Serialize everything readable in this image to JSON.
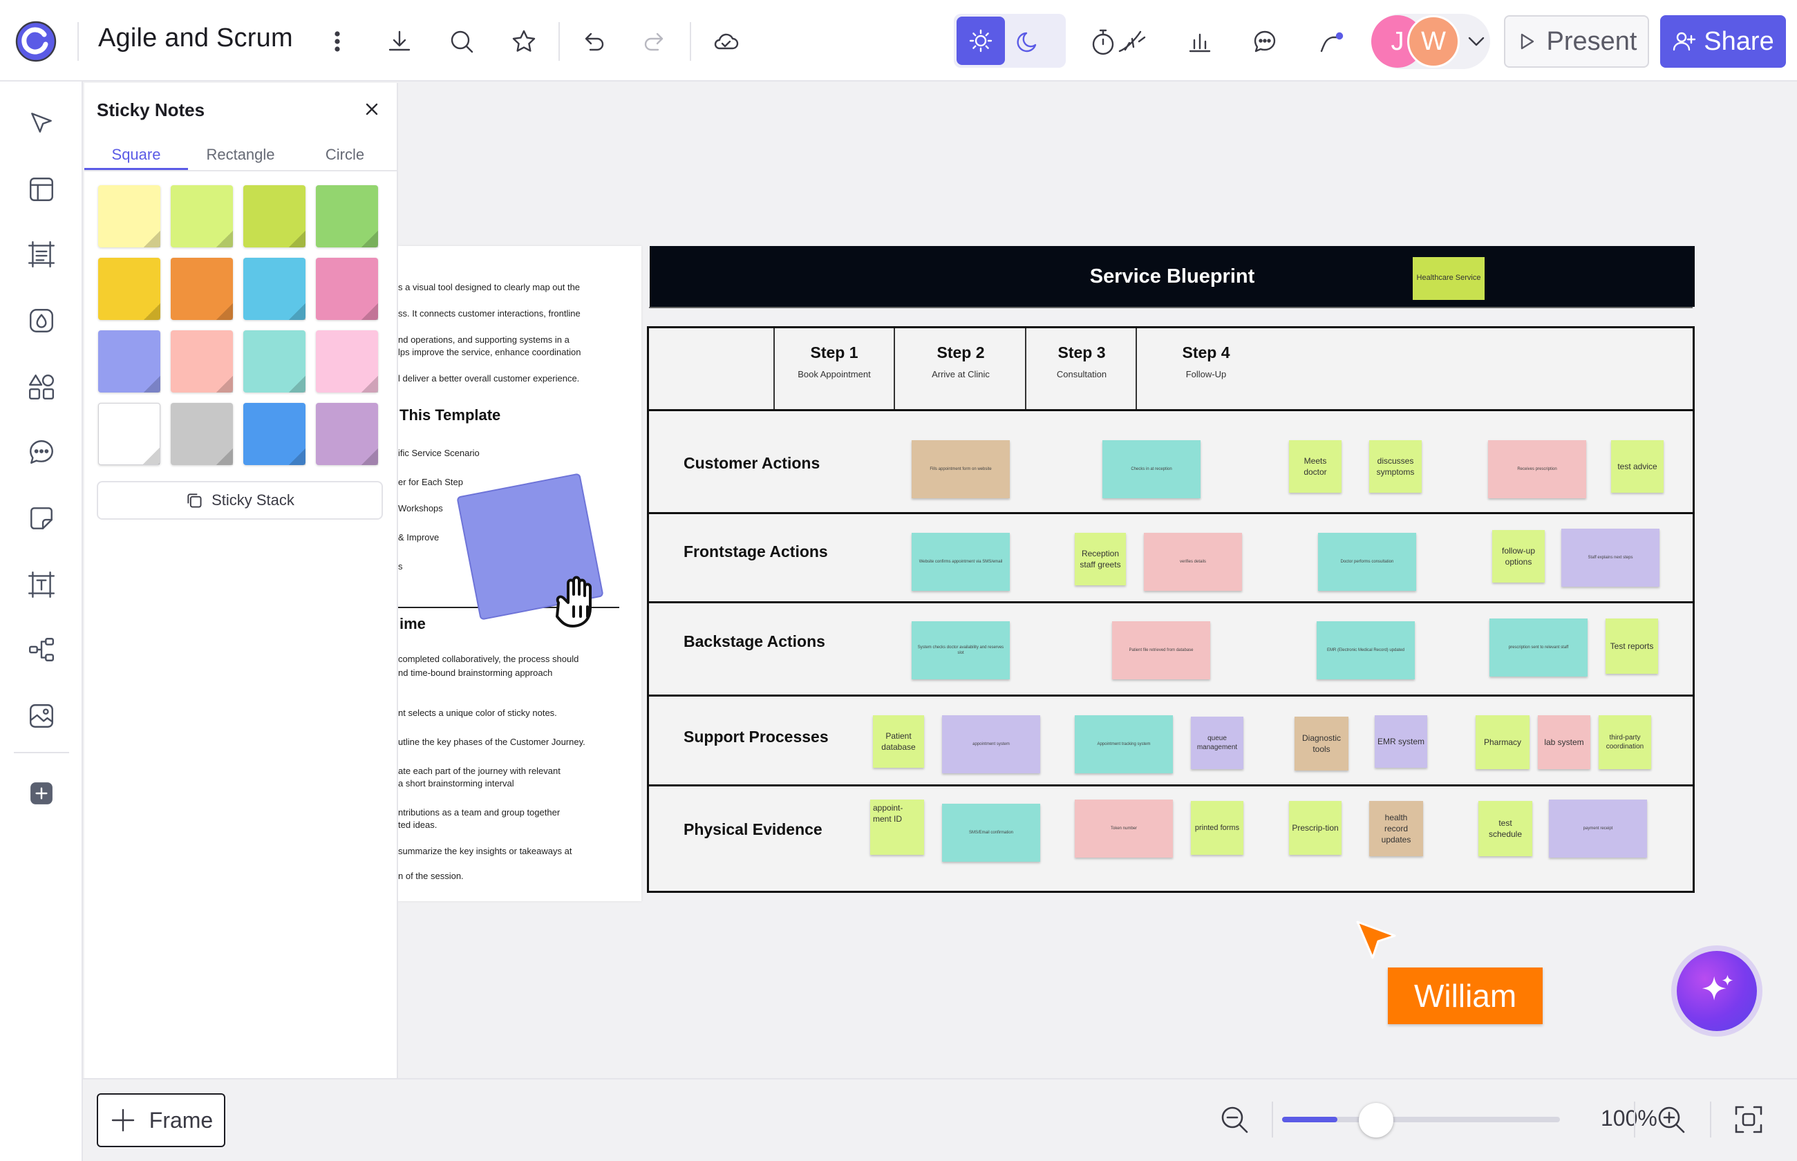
{
  "app": {
    "title": "Agile and Scrum",
    "present_label": "Present",
    "share_label": "Share",
    "avatars": [
      "J",
      "W"
    ],
    "accent": "#5b5be6"
  },
  "panel": {
    "title": "Sticky Notes",
    "tabs": [
      "Square",
      "Rectangle",
      "Circle"
    ],
    "active_tab": "Square",
    "swatches": [
      "#fff8a8",
      "#d8f37c",
      "#c7df4f",
      "#93d56f",
      "#f5ce2e",
      "#f0923d",
      "#5dc6e8",
      "#ec8fb8",
      "#959ef0",
      "#fdbcb4",
      "#91e0d8",
      "#fdc6e0",
      "#ffffff",
      "#c7c7c7",
      "#4d9aef",
      "#c49fd3"
    ],
    "stack_label": "Sticky Stack"
  },
  "doc": {
    "lines": [
      "s a visual tool designed to clearly map out the",
      "ss. It connects customer interactions, frontline",
      "nd operations, and supporting systems in a",
      "lps improve the service, enhance coordination",
      "l deliver a better overall customer experience."
    ],
    "heading1": "This Template",
    "steps": [
      "ific Service Scenario",
      "er for Each Step",
      "Workshops",
      "& Improve",
      "s"
    ],
    "heading2": "ime",
    "body2": [
      "completed collaboratively, the process should",
      "nd time-bound brainstorming approach"
    ],
    "list2": [
      "nt selects a unique color of sticky notes.",
      "utline the key phases of the Customer Journey.",
      "ate each part of the journey with relevant",
      "a short brainstorming interval",
      "ntributions as a team and group together",
      "ted ideas.",
      "summarize the key insights or takeaways at",
      "n of the session."
    ]
  },
  "blueprint": {
    "title": "Service Blueprint",
    "badge": "Healthcare Service",
    "steps": [
      {
        "title": "Step 1",
        "sub": "Book Appointment"
      },
      {
        "title": "Step 2",
        "sub": "Arrive at Clinic"
      },
      {
        "title": "Step 3",
        "sub": "Consultation"
      },
      {
        "title": "Step 4",
        "sub": "Follow-Up"
      }
    ],
    "rows": [
      "Customer Actions",
      "Frontstage Actions",
      "Backstage Actions",
      "Support Processes",
      "Physical Evidence"
    ],
    "notes": {
      "ca1": "Fills appointment form on website",
      "ca2": "Checks in at reception",
      "ca3": "Meets doctor",
      "ca4": "discusses symptoms",
      "ca5": "Receives prescription",
      "ca6": "test advice",
      "fa1": "Website confirms appointment via SMS/email",
      "fa2": "Reception staff greets",
      "fa3": "verifies details",
      "fa4": "Doctor performs consultation",
      "fa5": "follow-up options",
      "fa6": "Staff explains next steps",
      "ba1": "System checks doctor availability and reserves slot",
      "ba2": "Patient file retrieved from database",
      "ba3": "EMR (Electronic Medical Record) updated",
      "ba4": "prescription sent to relevant staff",
      "ba5": "Test reports",
      "sp1": "Patient database",
      "sp2": "appointment system",
      "sp3": "Appointment tracking system",
      "sp4": "queue management",
      "sp5": "Diagnostic tools",
      "sp6": "EMR system",
      "sp7": "Pharmacy",
      "sp8": "lab system",
      "sp9": "third-party coordination",
      "pe1": "appoint-ment ID",
      "pe2": "SMS/Email confirmation",
      "pe3": "Token number",
      "pe4": "printed forms",
      "pe5": "Prescrip-tion",
      "pe6": "health record updates",
      "pe7": "test schedule",
      "pe8": "payment receipt"
    }
  },
  "collab": {
    "cursor_name": "William",
    "cursor_color": "#ff7a00"
  },
  "bottom": {
    "frame_label": "Frame",
    "zoom": "100%",
    "zoom_fraction": 0.2
  }
}
